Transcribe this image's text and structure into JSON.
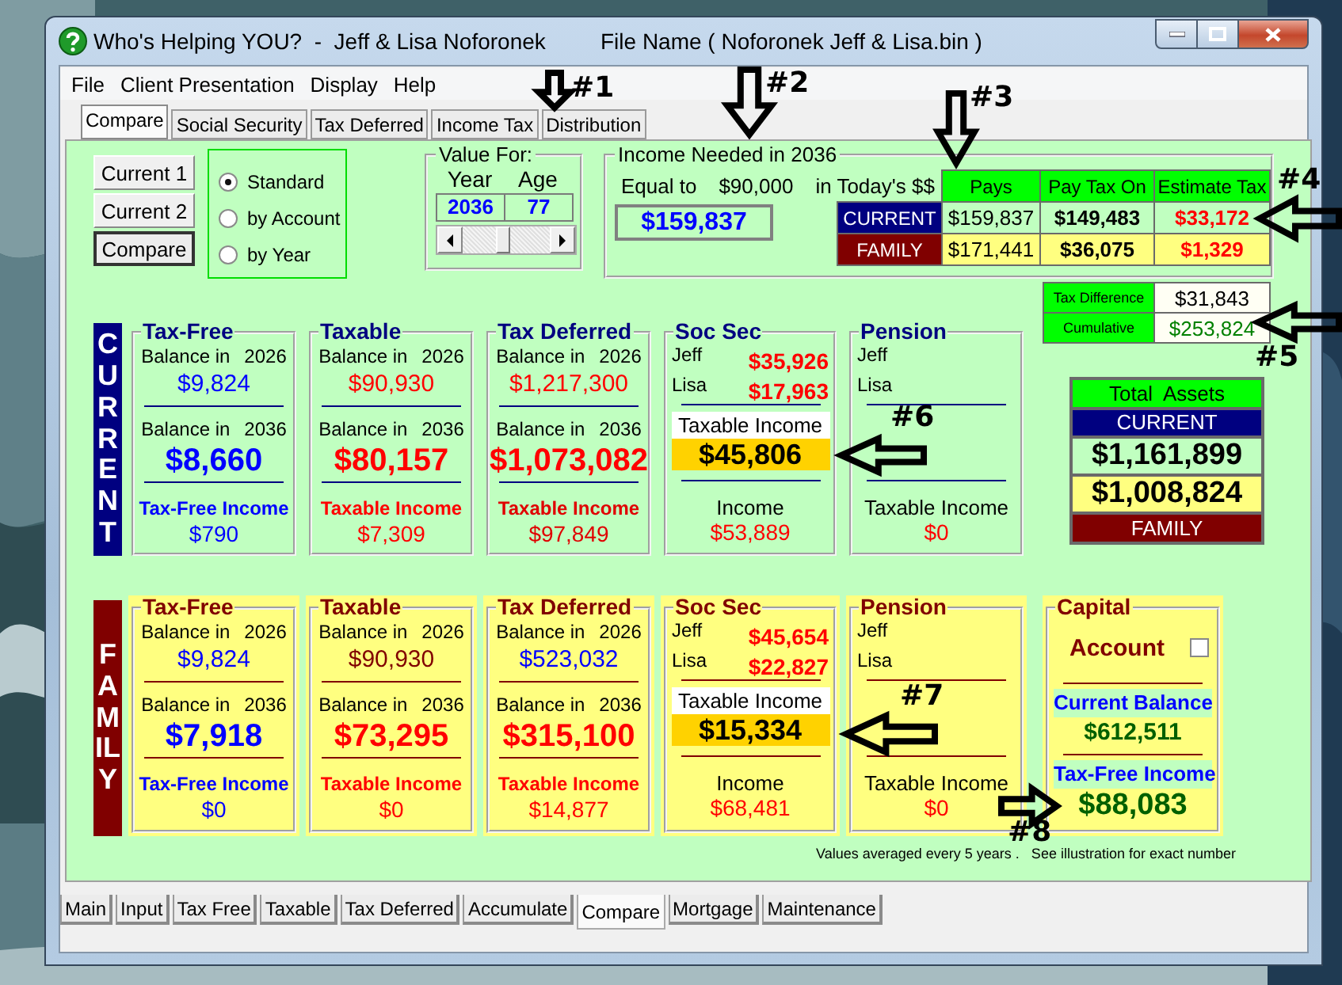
{
  "window": {
    "title": "Who's Helping YOU?  -  Jeff & Lisa Noforonek",
    "file_name": "File Name ( Noforonek Jeff & Lisa.bin )"
  },
  "menu": [
    "File",
    "Client Presentation",
    "Display",
    "Help"
  ],
  "tabs": [
    {
      "label": "Compare",
      "selected": true
    },
    {
      "label": "Social Security",
      "selected": false
    },
    {
      "label": "Tax Deferred",
      "selected": false
    },
    {
      "label": "Income Tax",
      "selected": false
    },
    {
      "label": "Distribution",
      "selected": false
    }
  ],
  "view_buttons": [
    {
      "label": "Current 1",
      "selected": false
    },
    {
      "label": "Current 2",
      "selected": false
    },
    {
      "label": "Compare",
      "selected": true
    }
  ],
  "mode_options": [
    {
      "label": "Standard",
      "selected": true
    },
    {
      "label": "by Account",
      "selected": false
    },
    {
      "label": "by Year",
      "selected": false
    }
  ],
  "value_for": {
    "title": "Value For:",
    "year_label": "Year",
    "age_label": "Age",
    "year": "2036",
    "age": "77",
    "level": 0.45
  },
  "income_needed": {
    "title": "Income Needed in 2036",
    "equal_label": "Equal to",
    "today_amount": "$90,000",
    "today_label": "in Today's $$",
    "amount": "$159,837"
  },
  "tax_table": {
    "columns": [
      "Pays",
      "Pay Tax On",
      "Estimate Tax"
    ],
    "rows": [
      {
        "label": "CURRENT",
        "kind": "current",
        "cells": [
          "$159,837",
          "$149,483",
          "$33,172"
        ]
      },
      {
        "label": "FAMILY",
        "kind": "family",
        "cells": [
          "$171,441",
          "$36,075",
          "$1,329"
        ]
      }
    ]
  },
  "tax_difference": [
    {
      "label": "Tax Difference",
      "value": "$31,843",
      "color": "#000000"
    },
    {
      "label": "Cumulative",
      "value": "$253,824",
      "color": "#008000"
    }
  ],
  "scenarios": [
    {
      "label": "CURRENT",
      "kind": "current",
      "cards": [
        {
          "kind": "balance",
          "title": "Tax-Free",
          "balances": [
            {
              "label": "Balance in",
              "year": "2026",
              "value": "$9,824",
              "color": "#0000ff"
            },
            {
              "label": "Balance in",
              "year": "2036",
              "value": "$8,660",
              "color": "#0000ff"
            }
          ],
          "income": {
            "label": "Tax-Free Income",
            "value": "$790",
            "color": "#0000ff"
          }
        },
        {
          "kind": "balance",
          "title": "Taxable",
          "balances": [
            {
              "label": "Balance in",
              "year": "2026",
              "value": "$90,930",
              "color": "#ff0000"
            },
            {
              "label": "Balance in",
              "year": "2036",
              "value": "$80,157",
              "color": "#ff0000"
            }
          ],
          "income": {
            "label": "Taxable Income",
            "value": "$7,309",
            "color": "#ff0000"
          }
        },
        {
          "kind": "balance",
          "title": "Tax Deferred",
          "balances": [
            {
              "label": "Balance in",
              "year": "2026",
              "value": "$1,217,300",
              "color": "#ff0000"
            },
            {
              "label": "Balance in",
              "year": "2036",
              "value": "$1,073,082",
              "color": "#ff0000"
            }
          ],
          "income": {
            "label": "Taxable Income",
            "value": "$97,849",
            "color": "#e00000"
          }
        },
        {
          "kind": "socsec",
          "title": "Soc Sec",
          "people": [
            {
              "name": "Jeff",
              "value": "$35,926"
            },
            {
              "name": "Lisa",
              "value": "$17,963"
            }
          ],
          "taxable_label": "Taxable Income",
          "taxable": "$45,806",
          "income_label": "Income",
          "income": "$53,889"
        },
        {
          "kind": "pension",
          "title": "Pension",
          "people": [
            {
              "name": "Jeff"
            },
            {
              "name": "Lisa"
            }
          ],
          "income_label": "Taxable Income",
          "income": "$0"
        }
      ]
    },
    {
      "label": "FAMILY",
      "kind": "family",
      "cards": [
        {
          "kind": "balance",
          "title": "Tax-Free",
          "balances": [
            {
              "label": "Balance in",
              "year": "2026",
              "value": "$9,824",
              "color": "#0000ff"
            },
            {
              "label": "Balance in",
              "year": "2036",
              "value": "$7,918",
              "color": "#0000ff"
            }
          ],
          "income": {
            "label": "Tax-Free Income",
            "value": "$0",
            "color": "#0000ff"
          }
        },
        {
          "kind": "balance",
          "title": "Taxable",
          "balances": [
            {
              "label": "Balance in",
              "year": "2026",
              "value": "$90,930",
              "color": "#800000"
            },
            {
              "label": "Balance in",
              "year": "2036",
              "value": "$73,295",
              "color": "#ff0000"
            }
          ],
          "income": {
            "label": "Taxable Income",
            "value": "$0",
            "color": "#ff0000"
          }
        },
        {
          "kind": "balance",
          "title": "Tax Deferred",
          "balances": [
            {
              "label": "Balance in",
              "year": "2026",
              "value": "$523,032",
              "color": "#0000ff"
            },
            {
              "label": "Balance in",
              "year": "2036",
              "value": "$315,100",
              "color": "#ff0000"
            }
          ],
          "income": {
            "label": "Taxable Income",
            "value": "$14,877",
            "color": "#ff0000"
          }
        },
        {
          "kind": "socsec",
          "title": "Soc Sec",
          "people": [
            {
              "name": "Jeff",
              "value": "$45,654"
            },
            {
              "name": "Lisa",
              "value": "$22,827"
            }
          ],
          "taxable_label": "Taxable Income",
          "taxable": "$15,334",
          "income_label": "Income",
          "income": "$68,481"
        },
        {
          "kind": "pension",
          "title": "Pension",
          "people": [
            {
              "name": "Jeff"
            },
            {
              "name": "Lisa"
            }
          ],
          "income_label": "Taxable Income",
          "income": "$0"
        },
        {
          "kind": "capital",
          "title": "Capital",
          "account_label": "Account",
          "checked": false,
          "balance_label": "Current Balance",
          "balance": "$612,511",
          "income_label": "Tax-Free Income",
          "income": "$88,083"
        }
      ]
    }
  ],
  "total_assets": {
    "title": "Total  Assets",
    "current_label": "CURRENT",
    "current": "$1,161,899",
    "family": "$1,008,824",
    "family_label": "FAMILY"
  },
  "footnote": "Values averaged every 5 years .   See illustration for exact number",
  "bottom_tabs": [
    {
      "label": "Main",
      "selected": false
    },
    {
      "label": "Input",
      "selected": false
    },
    {
      "label": "Tax Free",
      "selected": false
    },
    {
      "label": "Taxable",
      "selected": false
    },
    {
      "label": "Tax Deferred",
      "selected": false
    },
    {
      "label": "Accumulate",
      "selected": false
    },
    {
      "label": "Compare",
      "selected": true
    },
    {
      "label": "Mortgage",
      "selected": false
    },
    {
      "label": "Maintenance",
      "selected": false
    }
  ],
  "annotations": [
    {
      "label": "#1",
      "kind": "down"
    },
    {
      "label": "#2",
      "kind": "down"
    },
    {
      "label": "#3",
      "kind": "down"
    },
    {
      "label": "#4",
      "kind": "left"
    },
    {
      "label": "#5",
      "kind": "left"
    },
    {
      "label": "#6",
      "kind": "left"
    },
    {
      "label": "#7",
      "kind": "left"
    },
    {
      "label": "#8",
      "kind": "right"
    }
  ]
}
